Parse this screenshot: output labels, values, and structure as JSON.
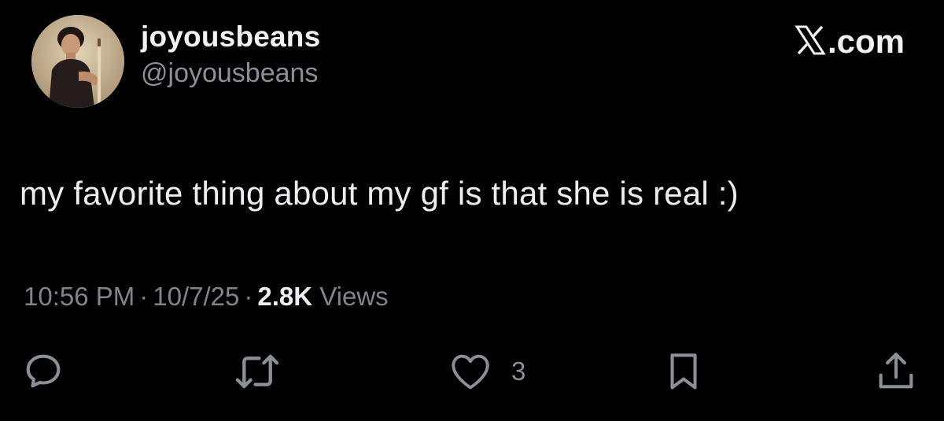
{
  "author": {
    "display_name": "joyousbeans",
    "handle": "@joyousbeans"
  },
  "brand": {
    "label": ".com",
    "icon": "x-logo-icon"
  },
  "tweet": {
    "text": "my favorite thing about my gf is that she is real :)"
  },
  "meta": {
    "time": "10:56 PM",
    "separator": "·",
    "date": "10/7/25",
    "views_count": "2.8K",
    "views_label": "Views"
  },
  "actions": {
    "reply_icon": "reply-icon",
    "retweet_icon": "retweet-icon",
    "like_icon": "heart-icon",
    "like_count": "3",
    "bookmark_icon": "bookmark-icon",
    "share_icon": "share-icon"
  },
  "colors": {
    "background": "#000000",
    "primary_text": "#e7e9ea",
    "secondary_text": "#8b9096"
  }
}
